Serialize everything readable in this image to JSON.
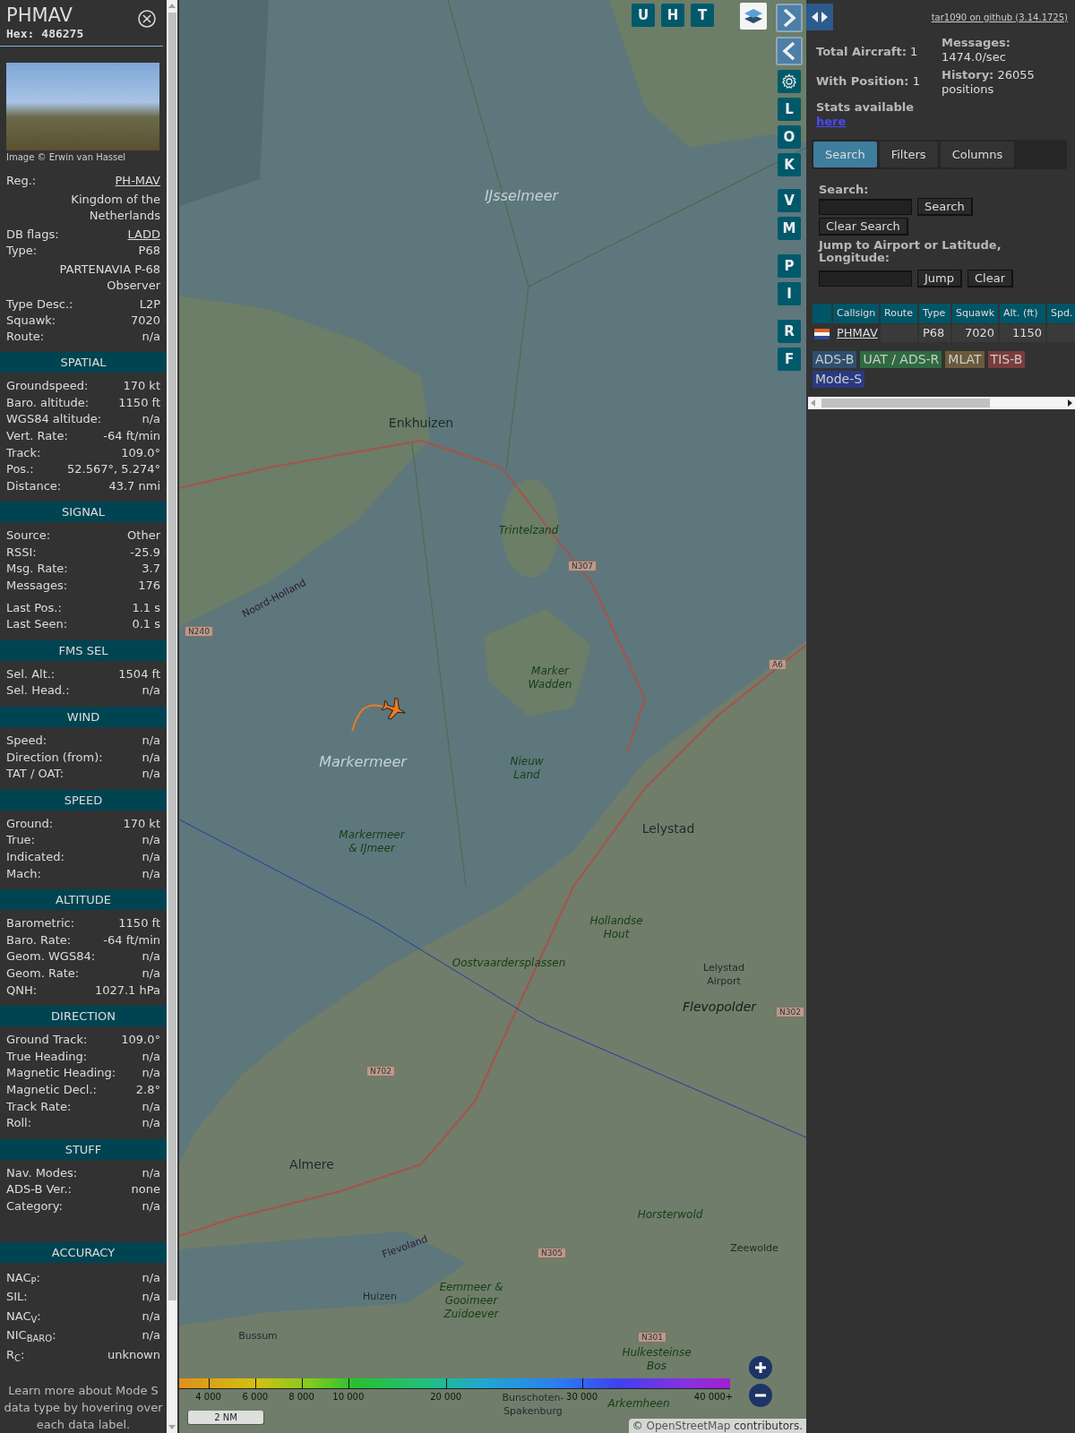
{
  "aircraft_panel": {
    "title": "PHMAV",
    "hex_label": "Hex:",
    "hex": "486275",
    "photo_caption": "Image © Erwin van Hassel",
    "details": [
      {
        "label": "Reg.:",
        "value": "PH-MAV",
        "kind": "link"
      },
      {
        "value": "Kingdom of the Netherlands",
        "kind": "text"
      },
      {
        "label": "DB flags:",
        "value": "LADD",
        "kind": "link"
      },
      {
        "label": "Type:",
        "value": "P68",
        "kind": "text"
      },
      {
        "value": "PARTENAVIA P-68 Observer",
        "kind": "text"
      },
      {
        "label": "Type Desc.:",
        "value": "L2P",
        "kind": "text"
      },
      {
        "label": "Squawk:",
        "value": "7020",
        "kind": "text"
      },
      {
        "label": "Route:",
        "value": "n/a",
        "kind": "text"
      }
    ],
    "sections": [
      {
        "title": "SPATIAL",
        "rows": [
          {
            "label": "Groundspeed:",
            "value": "170 kt"
          },
          {
            "label": "Baro. altitude:",
            "value": "1150 ft"
          },
          {
            "label": "WGS84 altitude:",
            "value": "n/a"
          },
          {
            "label": "Vert. Rate:",
            "value": "-64 ft/min"
          },
          {
            "label": "Track:",
            "value": "109.0°"
          },
          {
            "label": "Pos.:",
            "value": "52.567°, 5.274°"
          },
          {
            "label": "Distance:",
            "value": "43.7 nmi"
          }
        ]
      },
      {
        "title": "SIGNAL",
        "rows": [
          {
            "label": "Source:",
            "value": "Other"
          },
          {
            "label": "RSSI:",
            "value": "-25.9"
          },
          {
            "label": "Msg. Rate:",
            "value": "3.7"
          },
          {
            "label": "Messages:",
            "value": "176"
          },
          {
            "label": "Last Pos.:",
            "value": "1.1 s"
          },
          {
            "label": "Last Seen:",
            "value": "0.1 s"
          }
        ]
      },
      {
        "title": "FMS SEL",
        "rows": [
          {
            "label": "Sel. Alt.:",
            "value": "1504 ft"
          },
          {
            "label": "Sel. Head.:",
            "value": "n/a"
          }
        ]
      },
      {
        "title": "WIND",
        "rows": [
          {
            "label": "Speed:",
            "value": "n/a"
          },
          {
            "label": "Direction (from):",
            "value": "n/a"
          },
          {
            "label": "TAT / OAT:",
            "value": "n/a"
          }
        ]
      },
      {
        "title": "SPEED",
        "rows": [
          {
            "label": "Ground:",
            "value": "170 kt"
          },
          {
            "label": "True:",
            "value": "n/a"
          },
          {
            "label": "Indicated:",
            "value": "n/a"
          },
          {
            "label": "Mach:",
            "value": "n/a"
          }
        ]
      },
      {
        "title": "ALTITUDE",
        "rows": [
          {
            "label": "Barometric:",
            "value": "1150 ft"
          },
          {
            "label": "Baro. Rate:",
            "value": "-64 ft/min"
          },
          {
            "label": "Geom. WGS84:",
            "value": "n/a"
          },
          {
            "label": "Geom. Rate:",
            "value": "n/a"
          },
          {
            "label": "QNH:",
            "value": "1027.1 hPa"
          }
        ]
      },
      {
        "title": "DIRECTION",
        "rows": [
          {
            "label": "Ground Track:",
            "value": "109.0°"
          },
          {
            "label": "True Heading:",
            "value": "n/a"
          },
          {
            "label": "Magnetic Heading:",
            "value": "n/a"
          },
          {
            "label": "Magnetic Decl.:",
            "value": "2.8°"
          },
          {
            "label": "Track Rate:",
            "value": "n/a"
          },
          {
            "label": "Roll:",
            "value": "n/a"
          }
        ]
      },
      {
        "title": "STUFF",
        "rows": [
          {
            "label": "Nav. Modes:",
            "value": "n/a"
          },
          {
            "label": "ADS-B Ver.:",
            "value": "none"
          },
          {
            "label": "Category:",
            "value": "n/a"
          }
        ]
      },
      {
        "title": "ACCURACY",
        "rows": [
          {
            "label": "NAC$_{P}$:",
            "value": "n/a"
          },
          {
            "label": "SIL:",
            "value": "n/a"
          },
          {
            "label": "NAC$_{V}$:",
            "value": "n/a"
          },
          {
            "label": "NIC$_{BARO}$:",
            "value": "n/a"
          },
          {
            "label": "R$_{C}$:",
            "value": "unknown"
          }
        ]
      }
    ],
    "footer": "Learn more about Mode S data type by hovering over each data label."
  },
  "map": {
    "labels": [
      {
        "text": "IJsselmeer",
        "kind": "water"
      },
      {
        "text": "Enkhuizen",
        "kind": "town"
      },
      {
        "text": "Trintelzand",
        "kind": "nature"
      },
      {
        "text": "Marker Wadden",
        "kind": "nature"
      },
      {
        "text": "Markermeer",
        "kind": "water"
      },
      {
        "text": "Nieuw Land",
        "kind": "nature"
      },
      {
        "text": "Markermeer & IJmeer",
        "kind": "nature"
      },
      {
        "text": "Lelystad",
        "kind": "town"
      },
      {
        "text": "Hollandse Hout",
        "kind": "nature"
      },
      {
        "text": "Oostvaardersplassen",
        "kind": "nature"
      },
      {
        "text": "Lelystad Airport",
        "kind": "small"
      },
      {
        "text": "Flevopolder",
        "kind": "region"
      },
      {
        "text": "Almere",
        "kind": "town"
      },
      {
        "text": "Horsterwold",
        "kind": "nature"
      },
      {
        "text": "Zeewolde",
        "kind": "small"
      },
      {
        "text": "Huizen",
        "kind": "small"
      },
      {
        "text": "Bussum",
        "kind": "small"
      },
      {
        "text": "Bunschoten-Spakenburg",
        "kind": "small"
      },
      {
        "text": "Flevoland",
        "kind": "border"
      },
      {
        "text": "Noord-Holland",
        "kind": "border"
      },
      {
        "text": "Hulkesteinse Bos",
        "kind": "nature"
      },
      {
        "text": "Arkemheen",
        "kind": "nature"
      },
      {
        "text": "Eemmeer & Gooimeer Zuidoever",
        "kind": "nature"
      },
      {
        "text": "N240",
        "kind": "road"
      },
      {
        "text": "N307",
        "kind": "road"
      },
      {
        "text": "A6",
        "kind": "road"
      },
      {
        "text": "N702",
        "kind": "road"
      },
      {
        "text": "N302",
        "kind": "road"
      },
      {
        "text": "N305",
        "kind": "road"
      },
      {
        "text": "N301",
        "kind": "road"
      }
    ],
    "top_buttons": [
      "U",
      "H",
      "T"
    ],
    "side_button_groups": [
      [
        "L",
        "O",
        "K"
      ],
      [
        "V",
        "M"
      ],
      [
        "P",
        "I"
      ],
      [
        "R",
        "F"
      ]
    ],
    "altitude_scale": [
      "4 000",
      "6 000",
      "8 000",
      "10 000",
      "20 000",
      "30 000",
      "40 000+"
    ],
    "scale_bar": "2 NM",
    "attribution": {
      "prefix": "© ",
      "link": "OpenStreetMap",
      "suffix": " contributors."
    }
  },
  "right_panel": {
    "version_link": "tar1090 on github (3.14.1725)",
    "stats_left": [
      {
        "label": "Total Aircraft:",
        "value": "1"
      },
      {
        "label": "With Position:",
        "value": "1"
      }
    ],
    "stats_right": [
      {
        "label": "Messages:",
        "value": "1474.0/sec"
      },
      {
        "label": "History:",
        "value": "26055 positions"
      }
    ],
    "stats_note": {
      "text": "Stats available",
      "link": "here"
    },
    "tabs": [
      {
        "label": "Search",
        "selected": true
      },
      {
        "label": "Filters",
        "selected": false
      },
      {
        "label": "Columns",
        "selected": false
      }
    ],
    "search": {
      "label": "Search:",
      "button": "Search",
      "clear_button": "Clear Search",
      "jump_label": "Jump to Airport or Latitude, Longitude:",
      "jump_button": "Jump",
      "jump_clear_button": "Clear"
    },
    "table": {
      "columns": [
        "Callsign",
        "Route",
        "Type",
        "Squawk",
        "Alt. (ft)",
        "Spd."
      ],
      "rows": [
        {
          "cells": [
            "PHMAV",
            null,
            "P68",
            "7020",
            "1150",
            null
          ]
        }
      ]
    },
    "legend": [
      {
        "label": "ADS-B",
        "color": "#2e4f6e"
      },
      {
        "label": "UAT / ADS-R",
        "color": "#2f6a40"
      },
      {
        "label": "MLAT",
        "color": "#6b5a3c"
      },
      {
        "label": "TIS-B",
        "color": "#7a3c3c"
      },
      {
        "label": "Mode-S",
        "color": "#2a3a80"
      }
    ]
  }
}
